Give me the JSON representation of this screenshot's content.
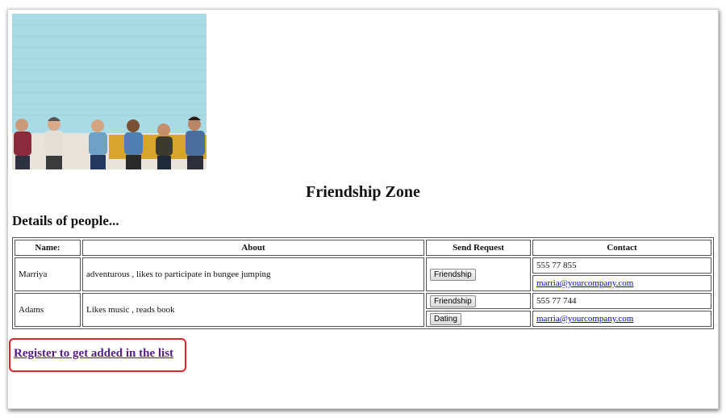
{
  "page": {
    "title": "Friendship Zone",
    "subtitle": "Details of people..."
  },
  "table": {
    "headers": [
      "Name:",
      "About",
      "Send Request",
      "Contact"
    ],
    "rows": [
      {
        "name": "Marriya",
        "about": "adventurous , likes to participate in bungee jumping",
        "request_button": "Friendship",
        "phone": "555 77 855",
        "email": "marria@yourcompany.com"
      },
      {
        "name": "Adams",
        "about": "Likes music , reads book",
        "request_buttons": [
          "Friendship",
          "Dating"
        ],
        "phone": "555 77 744",
        "email": "marria@yourcompany.com"
      }
    ]
  },
  "register_link": "Register to get added in the list",
  "colors": {
    "link_visited": "#551a8b",
    "link": "#0000ee",
    "highlight_border": "#d9262c",
    "photo_wall": "#a9dbe6"
  }
}
